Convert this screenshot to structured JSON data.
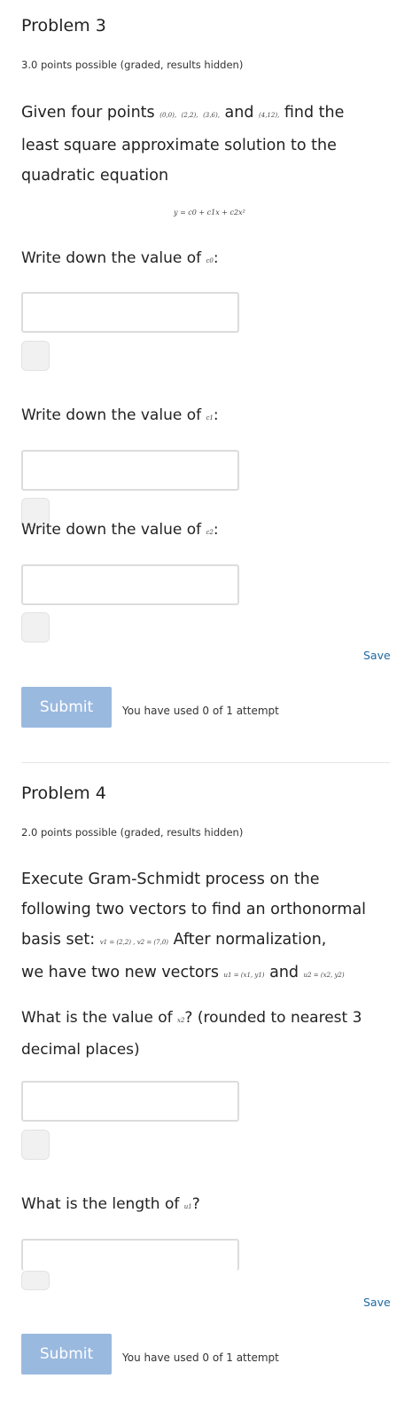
{
  "problem3": {
    "title": "Problem 3",
    "points": "3.0 points possible (graded, results hidden)",
    "q_l1_a": "Given four points ",
    "pt1": "(0,0)",
    "pt2": "(2,2)",
    "pt3": "(3,6)",
    "and": "and",
    "pt4": "(4,12)",
    "q_l1_b": "find the",
    "q_l2": "least square approximate solution to the",
    "q_l3": "quadratic equation",
    "equation": "y = c0 + c1x + c2x²",
    "prompt_c0": "Write down the value of",
    "var_c0": "c0",
    "prompt_c1": "Write down the value of",
    "var_c1": "c1",
    "prompt_c2": "Write down the value of",
    "var_c2": "c2",
    "colon": ":",
    "save": "Save",
    "submit": "Submit",
    "attempts": "You have used 0 of 1 attempt"
  },
  "problem4": {
    "title": "Problem 4",
    "points": "2.0 points possible (graded, results hidden)",
    "q_l1": "Execute Gram-Schmidt process on the",
    "q_l2": "following two vectors to find an orthonormal",
    "q_l3_a": "basis set: ",
    "vectors": "v1 = (2,2) , v2 = (7,0)",
    "q_l3_b": "After normalization,",
    "q_l4_a": "we have two new vectors ",
    "u1": "u1 = (x1, y1)",
    "q_l4_and": "and",
    "u2": "u2 = (x2, y2)",
    "q1_a": "What is the value of ",
    "q1_var": "x2",
    "q1_b": "? (rounded to nearest 3",
    "q1_l2": "decimal places)",
    "q2_a": "What is the length of ",
    "q2_var": "u1",
    "q2_b": "?",
    "save": "Save",
    "submit": "Submit",
    "attempts": "You have used 0 of 1 attempt"
  }
}
